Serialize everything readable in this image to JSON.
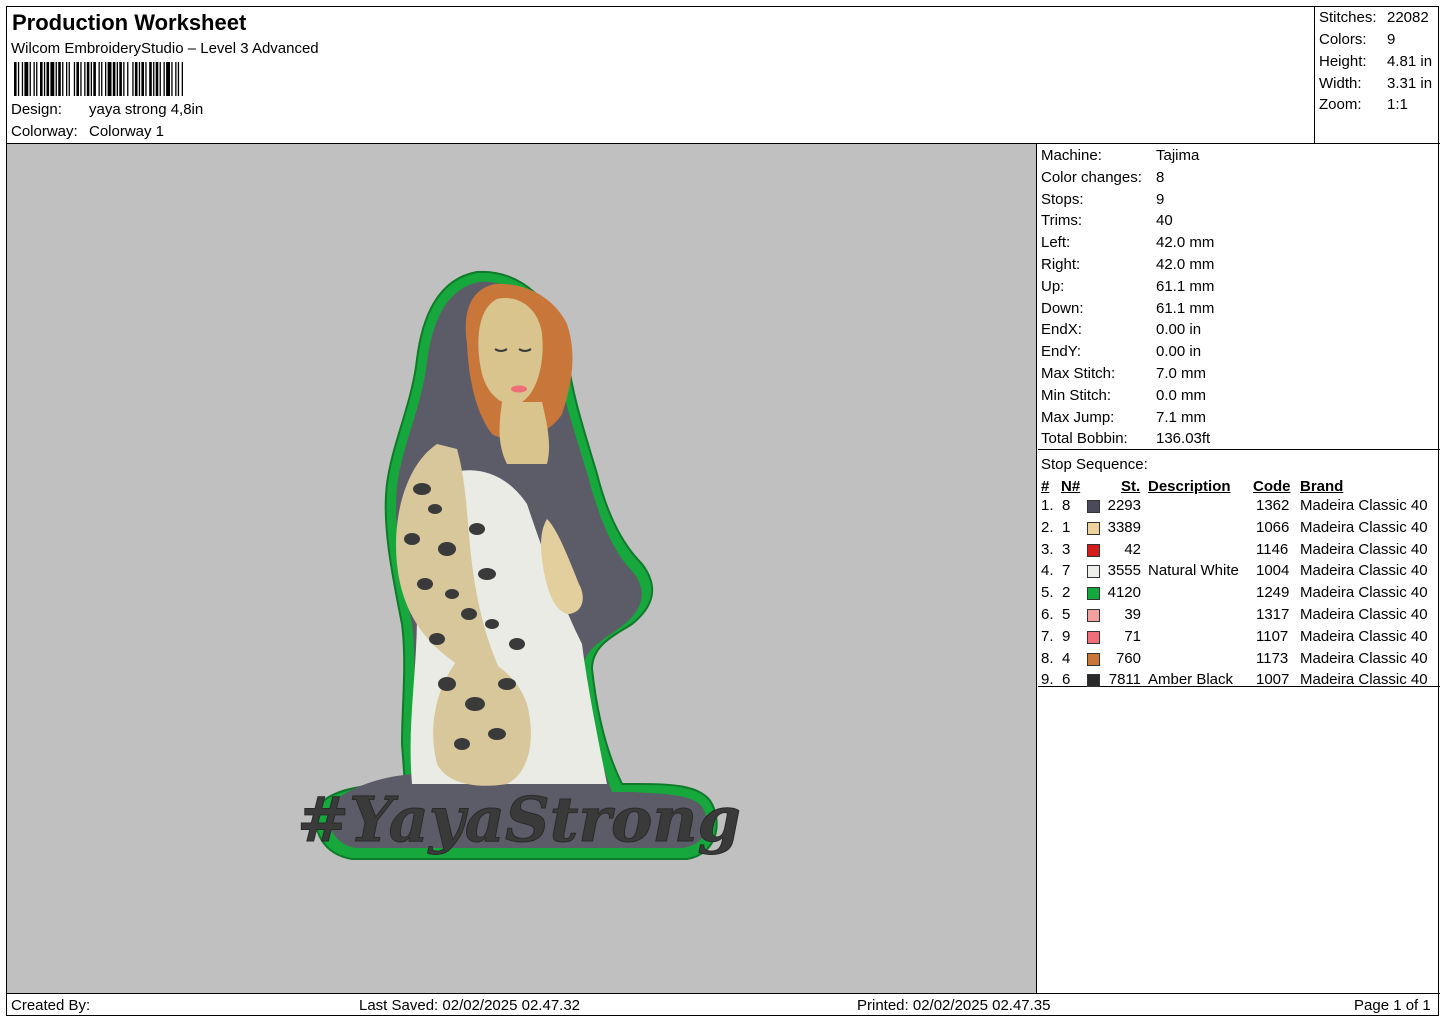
{
  "header": {
    "title": "Production Worksheet",
    "software": "Wilcom EmbroideryStudio – Level 3 Advanced",
    "design_label": "Design:",
    "design_value": "yaya strong 4,8in",
    "colorway_label": "Colorway:",
    "colorway_value": "Colorway 1"
  },
  "stats": [
    {
      "label": "Stitches:",
      "value": "22082"
    },
    {
      "label": "Colors:",
      "value": "9"
    },
    {
      "label": "Height:",
      "value": "4.81 in"
    },
    {
      "label": "Width:",
      "value": "3.31 in"
    },
    {
      "label": "Zoom:",
      "value": "1:1"
    }
  ],
  "machine_info": [
    {
      "label": "Machine:",
      "value": "Tajima"
    },
    {
      "label": "Color changes:",
      "value": "8"
    },
    {
      "label": "Stops:",
      "value": "9"
    },
    {
      "label": "Trims:",
      "value": "40"
    },
    {
      "label": "Left:",
      "value": "42.0 mm"
    },
    {
      "label": "Right:",
      "value": "42.0 mm"
    },
    {
      "label": "Up:",
      "value": "61.1 mm"
    },
    {
      "label": "Down:",
      "value": "61.1 mm"
    },
    {
      "label": "EndX:",
      "value": "0.00 in"
    },
    {
      "label": "EndY:",
      "value": "0.00 in"
    },
    {
      "label": "Max Stitch:",
      "value": "7.0 mm"
    },
    {
      "label": "Min Stitch:",
      "value": "0.0 mm"
    },
    {
      "label": "Max Jump:",
      "value": "7.1 mm"
    },
    {
      "label": "Total Bobbin:",
      "value": "136.03ft"
    }
  ],
  "stop_sequence": {
    "title": "Stop Sequence:",
    "headers": {
      "num": "#",
      "n": "N#",
      "st": "St.",
      "description": "Description",
      "code": "Code",
      "brand": "Brand"
    },
    "rows": [
      {
        "num": "1.",
        "n": "8",
        "color": "#4a4a5a",
        "st": "2293",
        "description": "",
        "code": "1362",
        "brand": "Madeira Classic 40"
      },
      {
        "num": "2.",
        "n": "1",
        "color": "#ecd29c",
        "st": "3389",
        "description": "",
        "code": "1066",
        "brand": "Madeira Classic 40"
      },
      {
        "num": "3.",
        "n": "3",
        "color": "#d41c1c",
        "st": "42",
        "description": "",
        "code": "1146",
        "brand": "Madeira Classic 40"
      },
      {
        "num": "4.",
        "n": "7",
        "color": "#eeeeea",
        "st": "3555",
        "description": "Natural White",
        "code": "1004",
        "brand": "Madeira Classic 40"
      },
      {
        "num": "5.",
        "n": "2",
        "color": "#16a83c",
        "st": "4120",
        "description": "",
        "code": "1249",
        "brand": "Madeira Classic 40"
      },
      {
        "num": "6.",
        "n": "5",
        "color": "#f2a0a0",
        "st": "39",
        "description": "",
        "code": "1317",
        "brand": "Madeira Classic 40"
      },
      {
        "num": "7.",
        "n": "9",
        "color": "#f06e78",
        "st": "71",
        "description": "",
        "code": "1107",
        "brand": "Madeira Classic 40"
      },
      {
        "num": "8.",
        "n": "4",
        "color": "#c9763a",
        "st": "760",
        "description": "",
        "code": "1173",
        "brand": "Madeira Classic 40"
      },
      {
        "num": "9.",
        "n": "6",
        "color": "#2a2a2a",
        "st": "7811",
        "description": "Amber Black",
        "code": "1007",
        "brand": "Madeira Classic 40"
      }
    ]
  },
  "preview": {
    "background": "#c0c0c0",
    "outline_color": "#16a83c",
    "text_color": "#3a3a3a",
    "caption_text": "#YayaStrong"
  },
  "footer": {
    "created_by": "Created By:",
    "last_saved": "Last Saved: 02/02/2025 02.47.32",
    "printed": "Printed: 02/02/2025 02.47.35",
    "page": "Page 1 of 1"
  }
}
